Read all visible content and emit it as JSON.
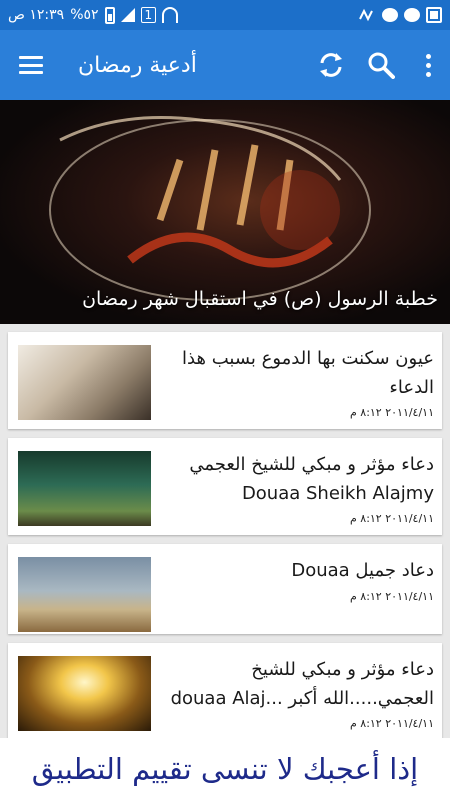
{
  "status_bar": {
    "time": "١٢:٣٩ ص",
    "battery": "%٥٢",
    "sim_slot": "1"
  },
  "app_bar": {
    "title": "أدعية رمضان",
    "icons": [
      "menu-icon",
      "refresh-icon",
      "search-icon",
      "more-vert-icon"
    ]
  },
  "hero": {
    "caption": "خطبة الرسول (ص) في استقبال شهر رمضان"
  },
  "items": [
    {
      "title": "عيون سكنت بها الدموع بسبب هذا الدعاء",
      "date": "٢٠١١/٤/١١ ٨:١٢ م",
      "thumb": "hands"
    },
    {
      "title": "دعاء مؤثر و مبكي للشيخ العجمي Douaa Sheikh Alajmy",
      "date": "٢٠١١/٤/١١ ٨:١٢ م",
      "thumb": "forest"
    },
    {
      "title": "دعاد جميل Douaa",
      "date": "٢٠١١/٤/١١ ٨:١٢ م",
      "thumb": "mosque"
    },
    {
      "title": "دعاء مؤثر و مبكي للشيخ العجمي.....الله أكبر ...douaa Alaj",
      "date": "٢٠١١/٤/١١ ٨:١٢ م",
      "thumb": "gold"
    }
  ],
  "banner": {
    "text": "إذا أعجبك لا تنسى تقييم التطبيق"
  },
  "colors": {
    "status_bar": "#1c6fc9",
    "app_bar": "#2b7fd9",
    "banner_text": "#1e2a8a"
  }
}
